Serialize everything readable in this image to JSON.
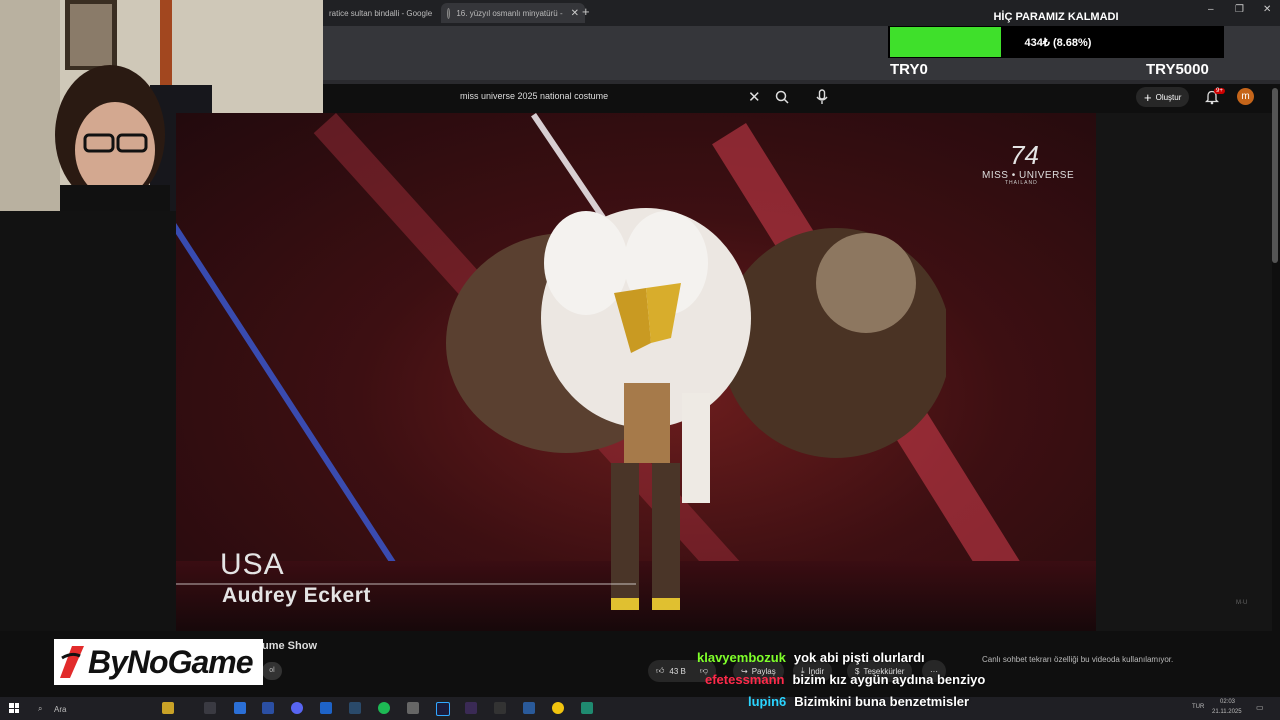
{
  "browser": {
    "tabs": [
      {
        "label": "ratice sultan bindalli - Google"
      },
      {
        "label": "16. yüzyıl osmanlı minyatürü -"
      }
    ],
    "new_tab_symbol": "+",
    "window_controls": [
      "–",
      "❐",
      "✕"
    ]
  },
  "youtube": {
    "search_value": "miss universe 2025 national costume",
    "clear_symbol": "✕",
    "create_label": "Oluştur",
    "notification_badge": "9+",
    "avatar_initial": "m"
  },
  "donation": {
    "title": "HİÇ PARAMIZ KALMADI",
    "progress_text": "434₺ (8.68%)",
    "progress_fraction": 0.0868,
    "min_label": "TRY0",
    "max_label": "TRY5000",
    "fill_color": "#3fe02b"
  },
  "video": {
    "country": "USA",
    "contestant": "Audrey Eckert",
    "logo_number": "74",
    "logo_brand": "MISS • UNIVERSE",
    "logo_country": "THAILAND",
    "corner_mark": "M·U"
  },
  "below_video": {
    "title_fragment": "ume Show",
    "subscribe_chip": "ol",
    "like_count": "43 B",
    "share_label": "Paylaş",
    "download_label": "İndir",
    "thanks_label": "Teşekkürler",
    "more_symbol": "···",
    "chat_disabled_note": "Canlı sohbet tekrarı özelliği bu videoda kullanılamıyor."
  },
  "overlay": {
    "logo_text": "ByNoGame"
  },
  "chat": [
    {
      "user": "klavyembozuk",
      "message": "yok abi pişti olurlardı",
      "user_color": "#7fff2a"
    },
    {
      "user": "efetessmann",
      "message": "bizim kız aygün aydına benziyo",
      "user_color": "#ff2a4a"
    },
    {
      "user": "lupin6",
      "message": "Bizimkini buna benzetmisler",
      "user_color": "#2ad4ff"
    }
  ],
  "taskbar": {
    "search_label": "Ara",
    "time": "02:03",
    "date": "21.11.2025",
    "lang": "TUR"
  }
}
